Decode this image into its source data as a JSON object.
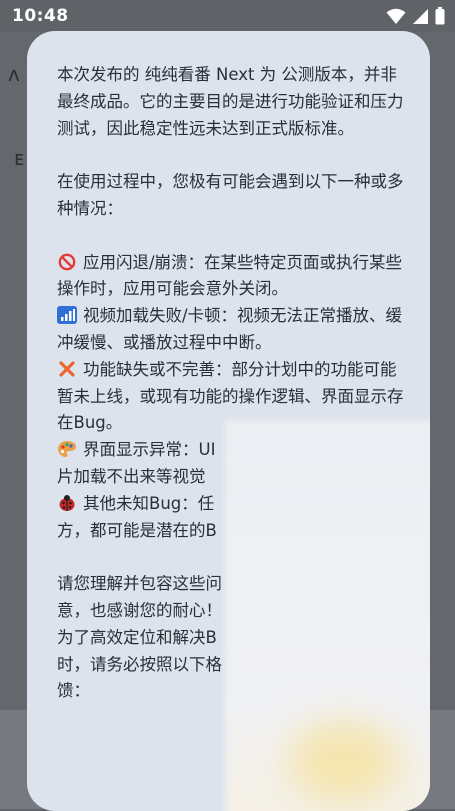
{
  "status_bar": {
    "time": "10:48",
    "icons": [
      "wifi-icon",
      "cellular-signal-icon",
      "battery-icon"
    ]
  },
  "dialog": {
    "intro": "本次发布的 纯纯看番 Next 为 公测版本，并非最终成品。它的主要目的是进行功能验证和压力测试，因此稳定性远未达到正式版标准。",
    "lead": "在使用过程中，您极有可能会遇到以下一种或多种情况：",
    "issues": [
      {
        "icon": "prohibited-icon",
        "text": "应用闪退/崩溃：在某些特定页面或执行某些操作时，应用可能会意外关闭。"
      },
      {
        "icon": "signal-bars-icon",
        "text": "视频加载失败/卡顿：视频无法正常播放、缓冲缓慢、或播放过程中中断。"
      },
      {
        "icon": "cross-mark-icon",
        "text": "功能缺失或不完善：部分计划中的功能可能暂未上线，或现有功能的操作逻辑、界面显示存在Bug。"
      },
      {
        "icon": "paint-palette-icon",
        "text": "界面显示异常：UI"
      },
      {
        "icon": "ladybug-icon",
        "text": "其他未知Bug：任"
      }
    ],
    "issue4_line2": "片加载不出来等视觉",
    "issue5_line2": "方，都可能是潜在的B",
    "closing_lines": [
      "请您理解并包容这些问",
      "意，也感谢您的耐心！",
      "为了高效定位和解决B",
      "时，请务必按照以下格",
      "馈："
    ]
  }
}
